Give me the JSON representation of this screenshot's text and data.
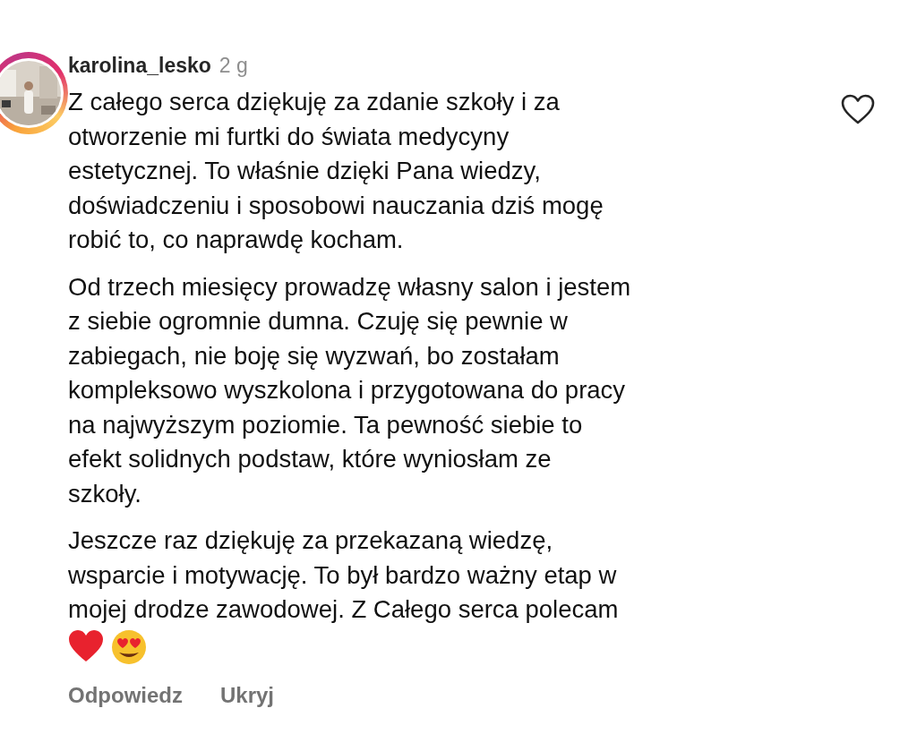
{
  "comment": {
    "username": "karolina_lesko",
    "time": "2 g",
    "has_story": true,
    "liked": false,
    "paragraphs": [
      "Z całego serca dziękuję za zdanie szkoły i za\notworzenie mi furtki do świata medycyny\nestetycznej. To właśnie dzięki Pana wiedzy,\ndoświadczeniu i sposobowi nauczania dziś mogę\nrobić to, co naprawdę kocham.",
      "Od trzech miesięcy prowadzę własny salon i jestem\nz siebie ogromnie dumna. Czuję się pewnie w\nzabiegach, nie boję się wyzwań, bo zostałam\nkompleksowo wyszkolona i przygotowana do pracy\nna najwyższym poziomie. Ta pewność siebie to\nefekt solidnych podstaw, które wyniosłam ze\nszkoły.",
      "Jeszcze raz dziękuję za przekazaną wiedzę,\nwsparcie i motywację. To był bardzo ważny etap w\nmojej drodze zawodowej. Z Całego serca polecam"
    ],
    "emojis": [
      {
        "kind": "heart"
      },
      {
        "kind": "heart-eyes"
      }
    ],
    "actions": [
      "Odpowiedz",
      "Ukryj"
    ]
  }
}
